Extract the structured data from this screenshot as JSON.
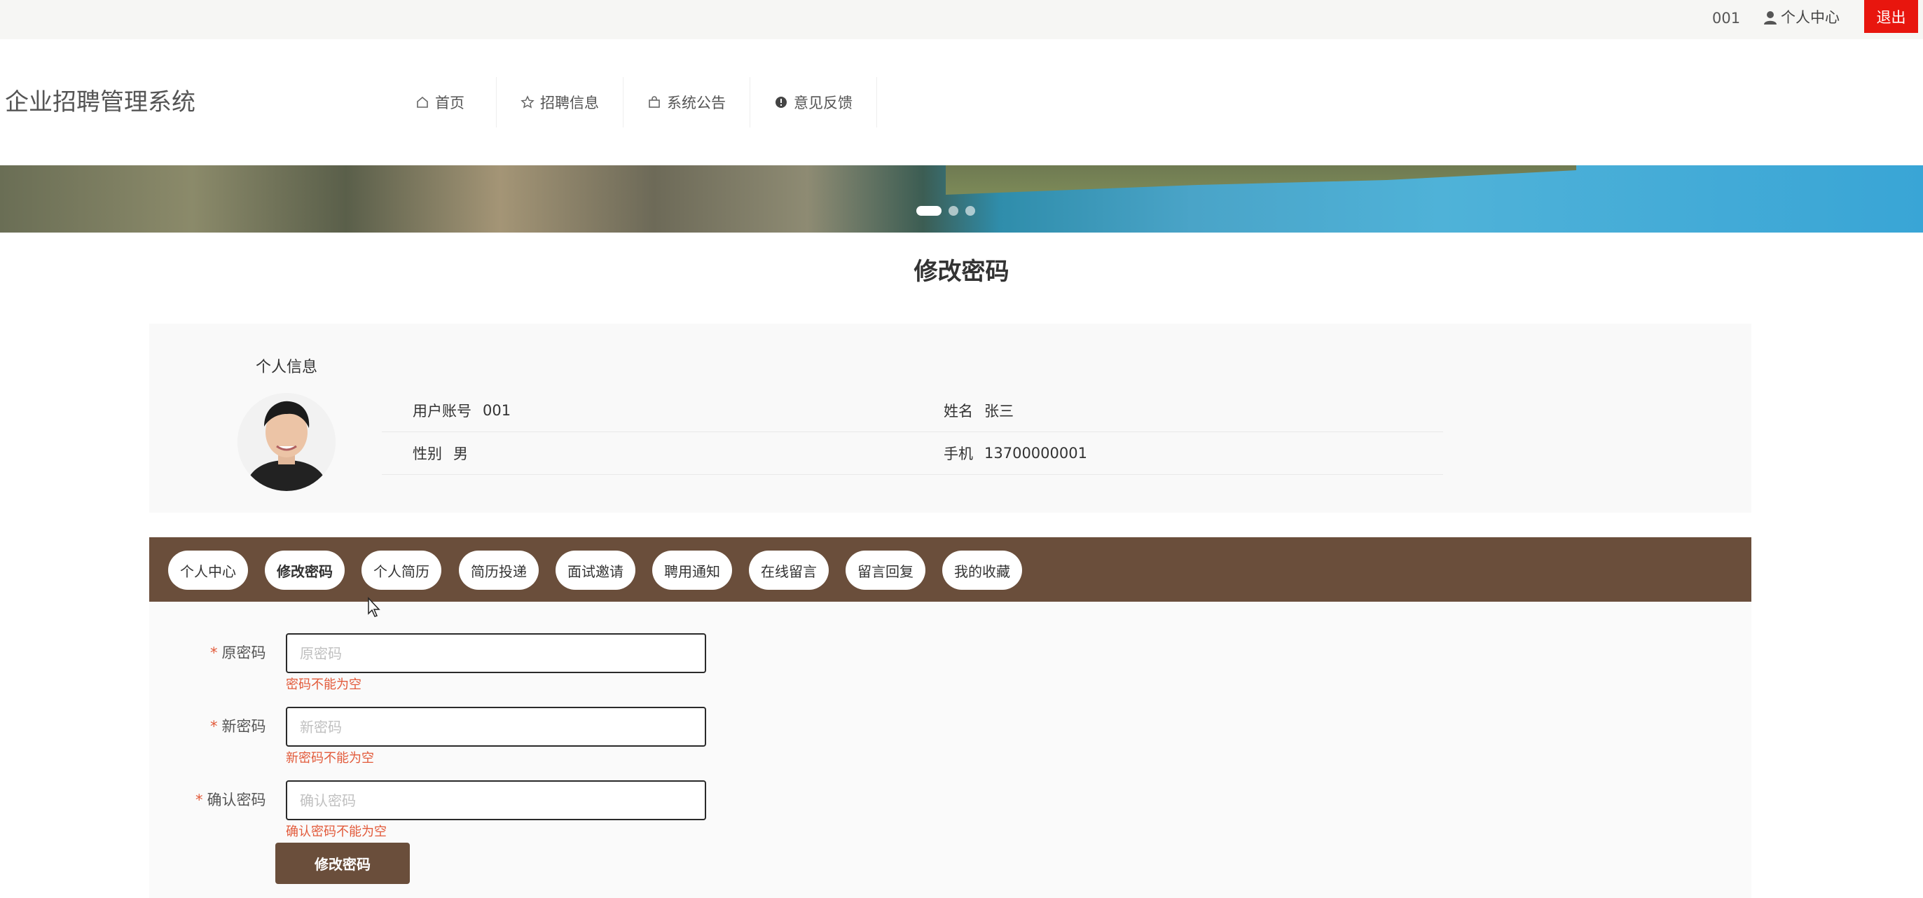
{
  "topbar": {
    "username": "001",
    "personal_center": "个人中心",
    "logout": "退出"
  },
  "header": {
    "site_title": "企业招聘管理系统",
    "nav": [
      {
        "label": "首页",
        "icon": "home-icon"
      },
      {
        "label": "招聘信息",
        "icon": "star-icon"
      },
      {
        "label": "系统公告",
        "icon": "bag-icon"
      },
      {
        "label": "意见反馈",
        "icon": "alert-circle-icon"
      }
    ]
  },
  "banner": {
    "slides": 3,
    "active_slide": 1
  },
  "page": {
    "title": "修改密码"
  },
  "profile": {
    "heading": "个人信息",
    "fields": {
      "account": {
        "label": "用户账号",
        "value": "001"
      },
      "name": {
        "label": "姓名",
        "value": "张三"
      },
      "gender": {
        "label": "性别",
        "value": "男"
      },
      "phone": {
        "label": "手机",
        "value": "13700000001"
      }
    }
  },
  "tabs": [
    {
      "label": "个人中心"
    },
    {
      "label": "修改密码",
      "active": true
    },
    {
      "label": "个人简历"
    },
    {
      "label": "简历投递"
    },
    {
      "label": "面试邀请"
    },
    {
      "label": "聘用通知"
    },
    {
      "label": "在线留言"
    },
    {
      "label": "留言回复"
    },
    {
      "label": "我的收藏"
    }
  ],
  "form": {
    "old_password": {
      "required_mark": "*",
      "label": "原密码",
      "placeholder": "原密码",
      "value": "",
      "error": "密码不能为空"
    },
    "new_password": {
      "required_mark": "*",
      "label": "新密码",
      "placeholder": "新密码",
      "value": "",
      "error": "新密码不能为空"
    },
    "confirm_password": {
      "required_mark": "*",
      "label": "确认密码",
      "placeholder": "确认密码",
      "value": "",
      "error": "确认密码不能为空"
    },
    "submit": "修改密码"
  },
  "colors": {
    "brand": "#6a4e3b",
    "logout": "#e8160e",
    "error": "#e25a3a"
  }
}
